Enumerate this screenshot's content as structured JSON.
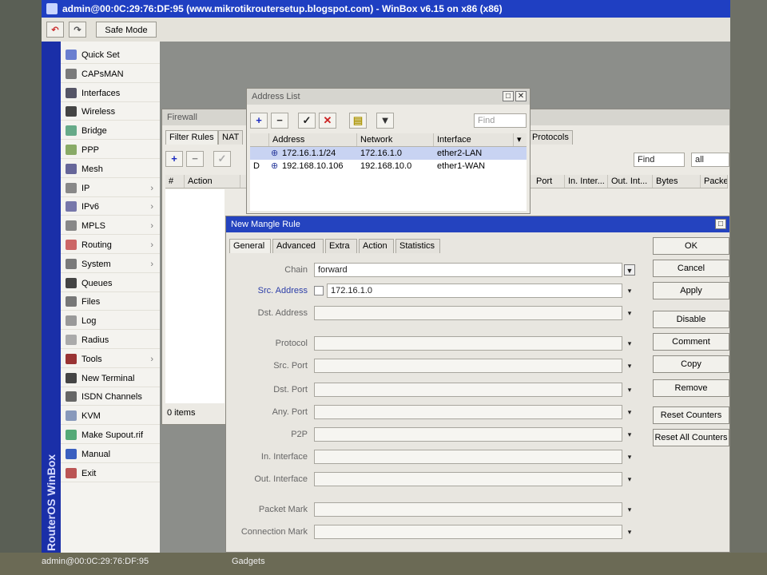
{
  "window": {
    "title": "admin@00:0C:29:76:DF:95 (www.mikrotikroutersetup.blogspot.com) - WinBox v6.15 on x86 (x86)"
  },
  "toolbar": {
    "undo_icon": "undo-icon",
    "redo_icon": "redo-icon",
    "safe_mode_label": "Safe Mode"
  },
  "brand": {
    "vertical_label": "RouterOS WinBox",
    "color": "#1a2fa8"
  },
  "sidebar": {
    "items": [
      {
        "label": "Quick Set",
        "icon": "quick-set-icon",
        "submenu": false
      },
      {
        "label": "CAPsMAN",
        "icon": "capsman-icon",
        "submenu": false
      },
      {
        "label": "Interfaces",
        "icon": "interfaces-icon",
        "submenu": false
      },
      {
        "label": "Wireless",
        "icon": "wireless-icon",
        "submenu": false
      },
      {
        "label": "Bridge",
        "icon": "bridge-icon",
        "submenu": false
      },
      {
        "label": "PPP",
        "icon": "ppp-icon",
        "submenu": false
      },
      {
        "label": "Mesh",
        "icon": "mesh-icon",
        "submenu": false
      },
      {
        "label": "IP",
        "icon": "ip-icon",
        "submenu": true
      },
      {
        "label": "IPv6",
        "icon": "ipv6-icon",
        "submenu": true
      },
      {
        "label": "MPLS",
        "icon": "mpls-icon",
        "submenu": true
      },
      {
        "label": "Routing",
        "icon": "routing-icon",
        "submenu": true
      },
      {
        "label": "System",
        "icon": "system-icon",
        "submenu": true
      },
      {
        "label": "Queues",
        "icon": "queues-icon",
        "submenu": false
      },
      {
        "label": "Files",
        "icon": "files-icon",
        "submenu": false
      },
      {
        "label": "Log",
        "icon": "log-icon",
        "submenu": false
      },
      {
        "label": "Radius",
        "icon": "radius-icon",
        "submenu": false
      },
      {
        "label": "Tools",
        "icon": "tools-icon",
        "submenu": true
      },
      {
        "label": "New Terminal",
        "icon": "terminal-icon",
        "submenu": false
      },
      {
        "label": "ISDN Channels",
        "icon": "isdn-icon",
        "submenu": false
      },
      {
        "label": "KVM",
        "icon": "kvm-icon",
        "submenu": false
      },
      {
        "label": "Make Supout.rif",
        "icon": "supout-icon",
        "submenu": false
      },
      {
        "label": "Manual",
        "icon": "manual-icon",
        "submenu": false
      },
      {
        "label": "Exit",
        "icon": "exit-icon",
        "submenu": false
      }
    ]
  },
  "firewall": {
    "title": "Firewall",
    "tabs": [
      "Filter Rules",
      "NAT"
    ],
    "right_tab": "Protocols",
    "find_placeholder": "Find",
    "filter_value": "all",
    "columns": [
      "#",
      "Action"
    ],
    "right_columns": [
      "Port",
      "In. Inter...",
      "Out. Int...",
      "Bytes",
      "Packets"
    ],
    "status": "0 items"
  },
  "address_list": {
    "title": "Address List",
    "find_placeholder": "Find",
    "columns": [
      "Address",
      "Network",
      "Interface"
    ],
    "rows": [
      {
        "flag": "",
        "address": "172.16.1.1/24",
        "network": "172.16.1.0",
        "interface": "ether2-LAN",
        "selected": true
      },
      {
        "flag": "D",
        "address": "192.168.10.106",
        "network": "192.168.10.0",
        "interface": "ether1-WAN",
        "selected": false
      }
    ]
  },
  "mangle_rule": {
    "title": "New Mangle Rule",
    "tabs": [
      "General",
      "Advanced",
      "Extra",
      "Action",
      "Statistics"
    ],
    "fields": [
      {
        "label": "Chain",
        "value": "forward",
        "enabled": true,
        "highlight": false
      },
      {
        "label": "Src. Address",
        "value": "172.16.1.0",
        "enabled": true,
        "highlight": true
      },
      {
        "label": "Dst. Address",
        "value": "",
        "enabled": false,
        "highlight": false
      },
      {
        "label": "Protocol",
        "value": "",
        "enabled": false,
        "highlight": false
      },
      {
        "label": "Src. Port",
        "value": "",
        "enabled": false,
        "highlight": false
      },
      {
        "label": "Dst. Port",
        "value": "",
        "enabled": false,
        "highlight": false
      },
      {
        "label": "Any. Port",
        "value": "",
        "enabled": false,
        "highlight": false
      },
      {
        "label": "P2P",
        "value": "",
        "enabled": false,
        "highlight": false
      },
      {
        "label": "In. Interface",
        "value": "",
        "enabled": false,
        "highlight": false
      },
      {
        "label": "Out. Interface",
        "value": "",
        "enabled": false,
        "highlight": false
      },
      {
        "label": "Packet Mark",
        "value": "",
        "enabled": false,
        "highlight": false
      },
      {
        "label": "Connection Mark",
        "value": "",
        "enabled": false,
        "highlight": false
      }
    ],
    "buttons": [
      "OK",
      "Cancel",
      "Apply",
      "Disable",
      "Comment",
      "Copy",
      "Remove",
      "Reset Counters",
      "Reset All Counters"
    ]
  },
  "taskbar": {
    "left_text": "admin@00:0C:29:76:DF:95",
    "center_text": "Gadgets"
  }
}
